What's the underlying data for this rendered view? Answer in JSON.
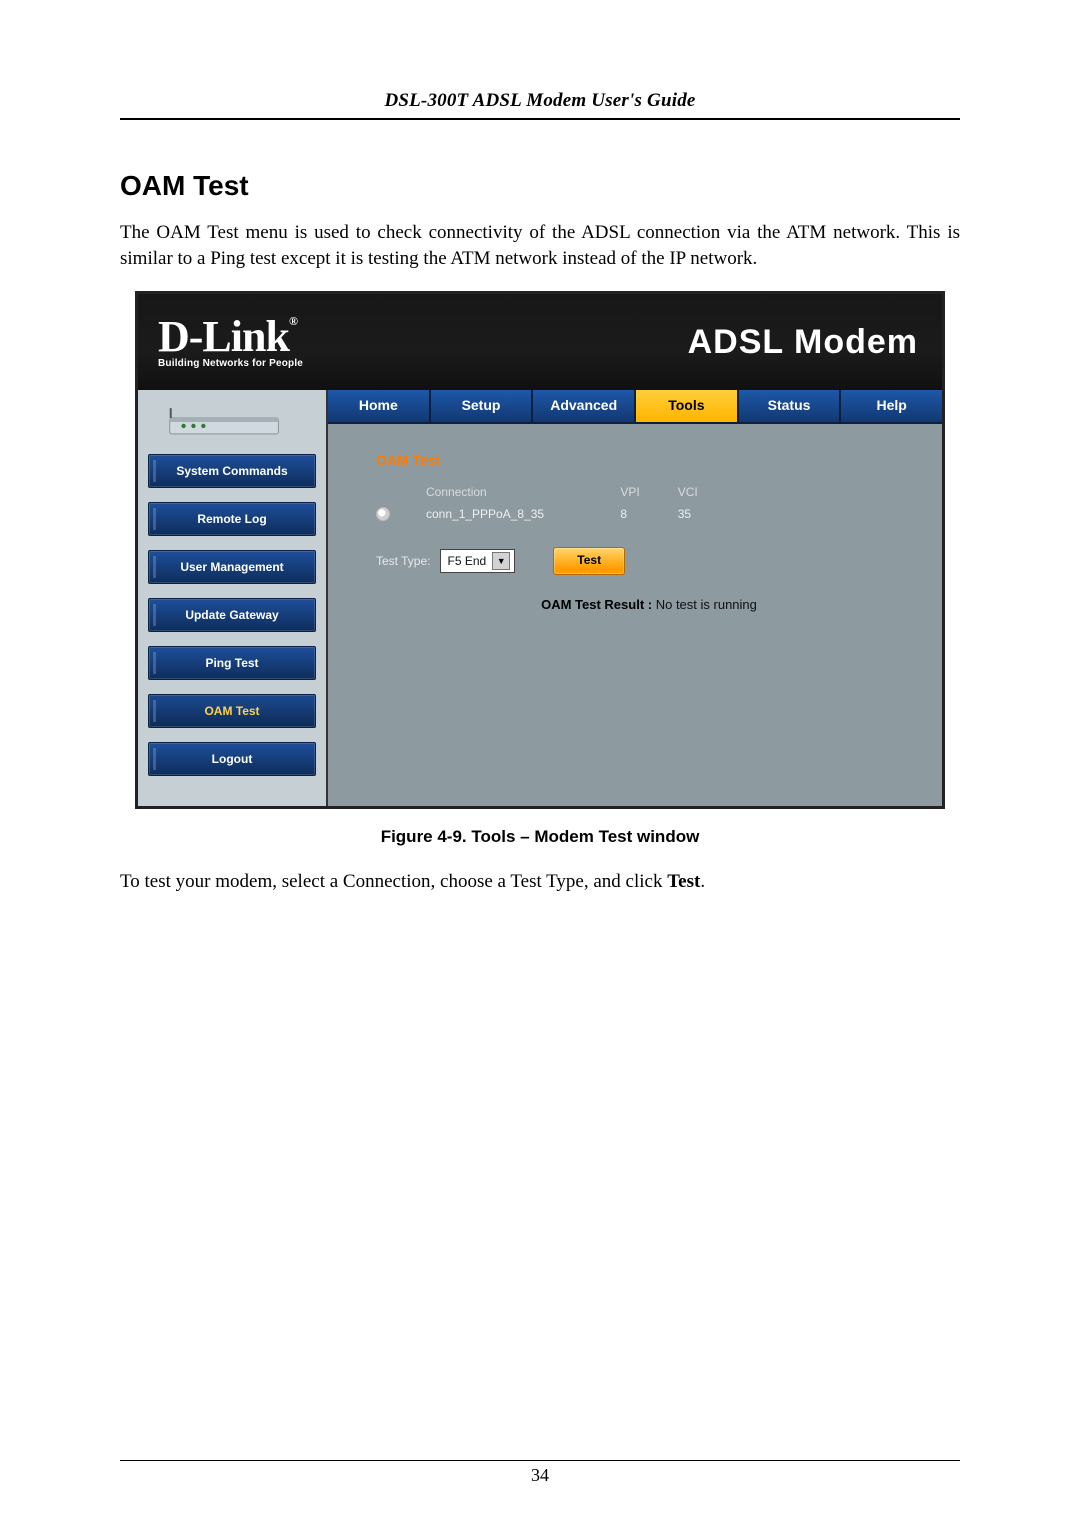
{
  "doc": {
    "header": "DSL-300T ADSL Modem User's Guide",
    "section_title": "OAM Test",
    "intro": "The OAM Test menu is used to check connectivity of the ADSL connection via the ATM network. This is similar to a Ping test except it is testing the ATM network instead of the IP network.",
    "figure_caption": "Figure 4-9. Tools – Modem Test window",
    "outro_prefix": "To test your modem, select a Connection, choose a Test Type, and click ",
    "outro_bold": "Test",
    "outro_suffix": ".",
    "page_number": "34"
  },
  "screenshot": {
    "brand": "D-Link",
    "brand_reg": "®",
    "brand_tag": "Building Networks for People",
    "product": "ADSL Modem",
    "tabs": {
      "home": "Home",
      "setup": "Setup",
      "advanced": "Advanced",
      "tools": "Tools",
      "status": "Status",
      "help": "Help"
    },
    "sidebar": {
      "system_commands": "System Commands",
      "remote_log": "Remote Log",
      "user_management": "User Management",
      "update_gateway": "Update Gateway",
      "ping_test": "Ping Test",
      "oam_test": "OAM Test",
      "logout": "Logout"
    },
    "panel": {
      "title": "OAM Test",
      "col_connection": "Connection",
      "col_vpi": "VPI",
      "col_vci": "VCI",
      "row_connection": "conn_1_PPPoA_8_35",
      "row_vpi": "8",
      "row_vci": "35",
      "test_type_label": "Test Type:",
      "test_type_value": "F5 End",
      "test_button": "Test",
      "result_label": "OAM Test Result :",
      "result_value": "No test is running"
    }
  }
}
